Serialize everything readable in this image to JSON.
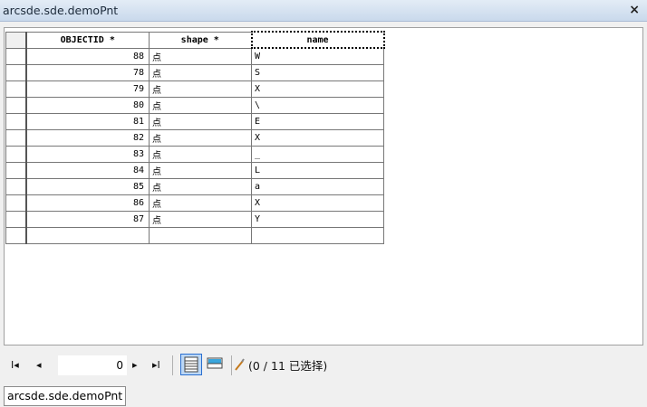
{
  "window": {
    "title": "arcsde.sde.demoPnt",
    "close_glyph": "×"
  },
  "table": {
    "columns": [
      "OBJECTID *",
      "shape *",
      "name"
    ],
    "rows": [
      {
        "id": "88",
        "shape": "点",
        "name": "W"
      },
      {
        "id": "78",
        "shape": "点",
        "name": "S"
      },
      {
        "id": "79",
        "shape": "点",
        "name": "X"
      },
      {
        "id": "80",
        "shape": "点",
        "name": "\\"
      },
      {
        "id": "81",
        "shape": "点",
        "name": "E"
      },
      {
        "id": "82",
        "shape": "点",
        "name": "X"
      },
      {
        "id": "83",
        "shape": "点",
        "name": "_"
      },
      {
        "id": "84",
        "shape": "点",
        "name": "L"
      },
      {
        "id": "85",
        "shape": "点",
        "name": "a"
      },
      {
        "id": "86",
        "shape": "点",
        "name": "X"
      },
      {
        "id": "87",
        "shape": "点",
        "name": "Y"
      }
    ]
  },
  "toolbar": {
    "first_glyph": "I◂",
    "prev_glyph": "◂",
    "record": "0",
    "next_glyph": "▸",
    "last_glyph": "▸I",
    "status": "(0 / 11 已选择)"
  },
  "icons": {
    "show_all": "table-all-records-icon",
    "show_selected": "table-selected-records-icon",
    "edit": "pencil-icon"
  },
  "colors": {
    "accent": "#2a6fd0",
    "selected_view": "#bcd7f5"
  },
  "tabs": [
    {
      "label": "arcsde.sde.demoPnt"
    }
  ]
}
